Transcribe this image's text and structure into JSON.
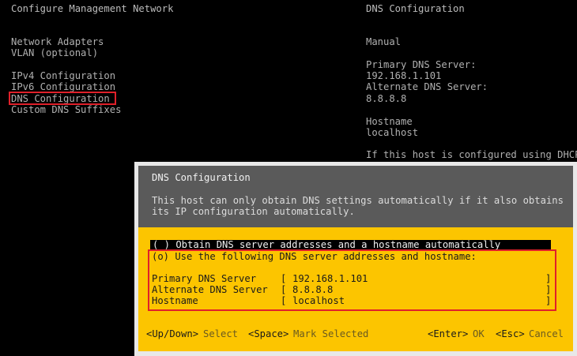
{
  "left_panel": {
    "title": "Configure Management Network",
    "menu": [
      {
        "label": "Network Adapters"
      },
      {
        "label": "VLAN (optional)"
      },
      {
        "label": "IPv4 Configuration"
      },
      {
        "label": "IPv6 Configuration"
      },
      {
        "label": "DNS Configuration",
        "selected": true
      },
      {
        "label": "Custom DNS Suffixes"
      }
    ]
  },
  "right_panel": {
    "title": "DNS Configuration",
    "mode": "Manual",
    "primary_label": "Primary DNS Server:",
    "primary_value": "192.168.1.101",
    "alternate_label": "Alternate DNS Server:",
    "alternate_value": "8.8.8.8",
    "hostname_label": "Hostname",
    "hostname_value": "localhost",
    "note": "If this host is configured using DHCP,"
  },
  "dialog": {
    "title": "DNS Configuration",
    "description_line1": "This host can only obtain DNS settings automatically if it also obtains",
    "description_line2": "its IP configuration automatically.",
    "option_auto": "( ) Obtain DNS server addresses and a hostname automatically",
    "option_manual": "(o) Use the following DNS server addresses and hostname:",
    "fields": [
      {
        "label": "Primary DNS Server",
        "value": "192.168.1.101"
      },
      {
        "label": "Alternate DNS Server",
        "value": "8.8.8.8"
      },
      {
        "label": "Hostname",
        "value": "localhost"
      }
    ],
    "footer": {
      "updown_key": "<Up/Down>",
      "updown_action": "Select",
      "space_key": "<Space>",
      "space_action": "Mark Selected",
      "enter_key": "<Enter>",
      "enter_action": "OK",
      "esc_key": "<Esc>",
      "esc_action": "Cancel"
    }
  }
}
